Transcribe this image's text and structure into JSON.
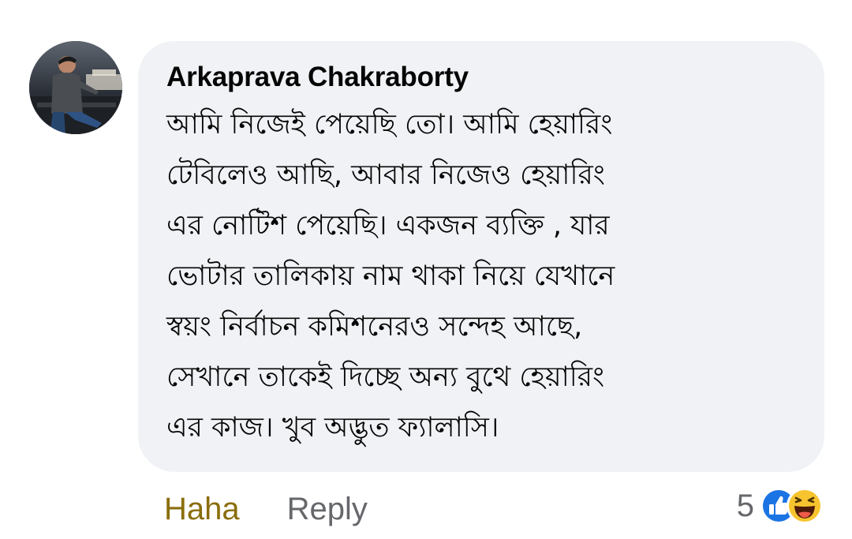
{
  "comment": {
    "author": "Arkaprava Chakraborty",
    "text_lines": [
      "আমি নিজেই পেয়েছি তো। আমি হেয়ারিং",
      "টেবিলেও আছি, আবার নিজেও হেয়ারিং",
      "এর নোটিশ পেয়েছি। একজন ব্যক্তি , যার",
      "ভোটার তালিকায় নাম থাকা নিয়ে যেখানে",
      "স্বয়ং নির্বাচন কমিশনেরও সন্দেহ আছে,",
      "সেখানে তাকেই দিচ্ছে অন্য বুথে হেয়ারিং",
      "এর কাজ। খুব অদ্ভুত ফ্যালাসি।"
    ]
  },
  "actions": {
    "reaction_label": "Haha",
    "reply_label": "Reply"
  },
  "reactions": {
    "count": "5",
    "icons": [
      "like-icon",
      "haha-icon"
    ]
  },
  "colors": {
    "bubble": "#f0f2f5",
    "haha_text": "#8a6d0b",
    "muted": "#65676b",
    "like_blue": "#1b74e4"
  }
}
